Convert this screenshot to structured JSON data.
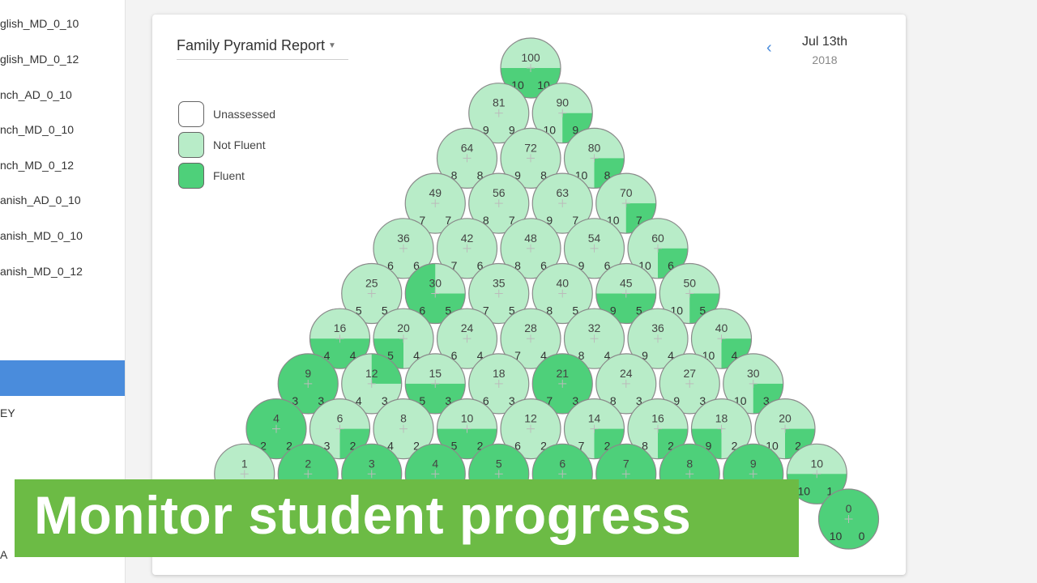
{
  "sidebar": {
    "items": [
      {
        "label": "glish_MD_0_10"
      },
      {
        "label": "glish_MD_0_12"
      },
      {
        "label": "nch_AD_0_10"
      },
      {
        "label": "nch_MD_0_10"
      },
      {
        "label": "nch_MD_0_12"
      },
      {
        "label": "anish_AD_0_10"
      },
      {
        "label": "anish_MD_0_10"
      },
      {
        "label": "anish_MD_0_12"
      }
    ],
    "extra1": "EY",
    "extra2": "A"
  },
  "report": {
    "title": "Family Pyramid Report"
  },
  "legend": [
    {
      "label": "Unassessed",
      "color": "#ffffff"
    },
    {
      "label": "Not Fluent",
      "color": "#b8ecc8"
    },
    {
      "label": "Fluent",
      "color": "#4ed07a"
    }
  ],
  "date": {
    "main": "Jul 13th",
    "year": "2018"
  },
  "colors": {
    "not_fluent": "#b8ecc8",
    "fluent": "#4ed07a",
    "accent": "#4a8cdc",
    "banner": "#6cbb45"
  },
  "chart_data": {
    "type": "table",
    "description_rows_top_to_bottom": true,
    "rows": [
      [
        {
          "v": 100,
          "a": 10,
          "b": 10,
          "f": "bottom"
        }
      ],
      [
        {
          "v": 81,
          "a": 9,
          "b": 9,
          "f": "none"
        },
        {
          "v": 90,
          "a": 10,
          "b": 9,
          "f": "br"
        }
      ],
      [
        {
          "v": 64,
          "a": 8,
          "b": 8,
          "f": "none"
        },
        {
          "v": 72,
          "a": 9,
          "b": 8,
          "f": "none"
        },
        {
          "v": 80,
          "a": 10,
          "b": 8,
          "f": "br"
        }
      ],
      [
        {
          "v": 49,
          "a": 7,
          "b": 7,
          "f": "none"
        },
        {
          "v": 56,
          "a": 8,
          "b": 7,
          "f": "none"
        },
        {
          "v": 63,
          "a": 9,
          "b": 7,
          "f": "none"
        },
        {
          "v": 70,
          "a": 10,
          "b": 7,
          "f": "br"
        }
      ],
      [
        {
          "v": 36,
          "a": 6,
          "b": 6,
          "f": "none"
        },
        {
          "v": 42,
          "a": 7,
          "b": 6,
          "f": "none"
        },
        {
          "v": 48,
          "a": 8,
          "b": 6,
          "f": "none"
        },
        {
          "v": 54,
          "a": 9,
          "b": 6,
          "f": "none"
        },
        {
          "v": 60,
          "a": 10,
          "b": 6,
          "f": "br"
        }
      ],
      [
        {
          "v": 25,
          "a": 5,
          "b": 5,
          "f": "none"
        },
        {
          "v": 30,
          "a": 6,
          "b": 5,
          "f": "tl-bottom"
        },
        {
          "v": 35,
          "a": 7,
          "b": 5,
          "f": "none"
        },
        {
          "v": 40,
          "a": 8,
          "b": 5,
          "f": "none"
        },
        {
          "v": 45,
          "a": 9,
          "b": 5,
          "f": "bottom"
        },
        {
          "v": 50,
          "a": 10,
          "b": 5,
          "f": "br"
        }
      ],
      [
        {
          "v": 16,
          "a": 4,
          "b": 4,
          "f": "bottom"
        },
        {
          "v": 20,
          "a": 5,
          "b": 4,
          "f": "bl"
        },
        {
          "v": 24,
          "a": 6,
          "b": 4,
          "f": "none"
        },
        {
          "v": 28,
          "a": 7,
          "b": 4,
          "f": "none"
        },
        {
          "v": 32,
          "a": 8,
          "b": 4,
          "f": "none"
        },
        {
          "v": 36,
          "a": 9,
          "b": 4,
          "f": "none"
        },
        {
          "v": 40,
          "a": 10,
          "b": 4,
          "f": "br"
        }
      ],
      [
        {
          "v": 9,
          "a": 3,
          "b": 3,
          "f": "full"
        },
        {
          "v": 12,
          "a": 4,
          "b": 3,
          "f": "tr"
        },
        {
          "v": 15,
          "a": 5,
          "b": 3,
          "f": "bottom"
        },
        {
          "v": 18,
          "a": 6,
          "b": 3,
          "f": "none"
        },
        {
          "v": 21,
          "a": 7,
          "b": 3,
          "f": "full"
        },
        {
          "v": 24,
          "a": 8,
          "b": 3,
          "f": "none"
        },
        {
          "v": 27,
          "a": 9,
          "b": 3,
          "f": "none"
        },
        {
          "v": 30,
          "a": 10,
          "b": 3,
          "f": "br"
        }
      ],
      [
        {
          "v": 4,
          "a": 2,
          "b": 2,
          "f": "full"
        },
        {
          "v": 6,
          "a": 3,
          "b": 2,
          "f": "br"
        },
        {
          "v": 8,
          "a": 4,
          "b": 2,
          "f": "none"
        },
        {
          "v": 10,
          "a": 5,
          "b": 2,
          "f": "bottom"
        },
        {
          "v": 12,
          "a": 6,
          "b": 2,
          "f": "none"
        },
        {
          "v": 14,
          "a": 7,
          "b": 2,
          "f": "br"
        },
        {
          "v": 16,
          "a": 8,
          "b": 2,
          "f": "br"
        },
        {
          "v": 18,
          "a": 9,
          "b": 2,
          "f": "bl"
        },
        {
          "v": 20,
          "a": 10,
          "b": 2,
          "f": "br"
        }
      ],
      [
        {
          "v": 1,
          "a": "",
          "b": "",
          "f": "none"
        },
        {
          "v": 2,
          "a": "",
          "b": "",
          "f": "full"
        },
        {
          "v": 3,
          "a": "",
          "b": "",
          "f": "full"
        },
        {
          "v": 4,
          "a": "",
          "b": "",
          "f": "full"
        },
        {
          "v": 5,
          "a": "",
          "b": "",
          "f": "full"
        },
        {
          "v": 6,
          "a": "",
          "b": "",
          "f": "full"
        },
        {
          "v": 7,
          "a": "",
          "b": "",
          "f": "full"
        },
        {
          "v": 8,
          "a": "",
          "b": "",
          "f": "full"
        },
        {
          "v": 9,
          "a": "",
          "b": "",
          "f": "full"
        },
        {
          "v": 10,
          "a": 10,
          "b": 1,
          "f": "bottom"
        }
      ],
      [
        {
          "v": 0,
          "a": 10,
          "b": 0,
          "f": "full"
        }
      ]
    ]
  },
  "banner": {
    "text": "Monitor student progress"
  }
}
